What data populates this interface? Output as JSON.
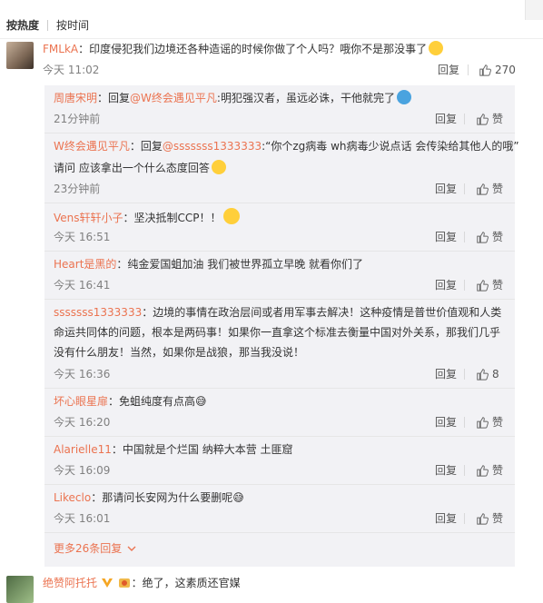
{
  "tabs": {
    "hot": "按热度",
    "time": "按时间"
  },
  "actions": {
    "reply": "回复",
    "like": "赞"
  },
  "top_comment": {
    "user": "FMLkA",
    "text": "：印度侵犯我们边境还各种造谣的时候你做了个人吗？哦你不是那没事了",
    "time": "今天 11:02",
    "likes": "270"
  },
  "sub_comments": [
    {
      "user": "周唐宋明",
      "reply_prefix": "：回复",
      "reply_to": "@W终会遇见平凡",
      "text": ":明犯强汉者，虽远必诛，干他就完了",
      "time": "21分钟前",
      "likes": ""
    },
    {
      "user": "W终会遇见平凡",
      "reply_prefix": "：回复",
      "reply_to": "@sssssss1333333",
      "text": ":“你个zg病毒 wh病毒少说点话 会传染给其他人的哦”",
      "text2": "请问 应该拿出一个什么态度回答",
      "time": "23分钟前",
      "likes": ""
    },
    {
      "user": "Vens轩轩小子",
      "text": "：坚决抵制CCP！！",
      "time": "今天 16:51",
      "likes": ""
    },
    {
      "user": "Heart是黑的",
      "text": "：纯金爱国蛆加油 我们被世界孤立早晚 就看你们了",
      "time": "今天 16:41",
      "likes": ""
    },
    {
      "user": "sssssss1333333",
      "text": "：边境的事情在政治层间或者用军事去解决！这种疫情是普世价值观和人类",
      "text2": "命运共同体的问题，根本是两码事！如果你一直拿这个标准去衡量中国对外关系，那我们几乎",
      "text3": "没有什么朋友！当然，如果你是战狼，那当我没说！",
      "time": "今天 16:36",
      "likes": "8"
    },
    {
      "user": "坏心眼星扉",
      "text": "：免蛆纯度有点高😅",
      "time": "今天 16:20",
      "likes": ""
    },
    {
      "user": "Alarielle11",
      "text": "：中国就是个烂国 纳粹大本营 土匪窟",
      "time": "今天 16:09",
      "likes": ""
    },
    {
      "user": "Likeclo",
      "text": "：那请问长安网为什么要删呢😅",
      "time": "今天 16:01",
      "likes": ""
    }
  ],
  "more_replies": "更多26条回复",
  "next_comment": {
    "user": "绝赞阿托托",
    "text": "：绝了，这素质还官媒"
  },
  "colors": {
    "username": "#eb7350",
    "sub_bg": "#f2f2f5",
    "meta": "#808080"
  }
}
